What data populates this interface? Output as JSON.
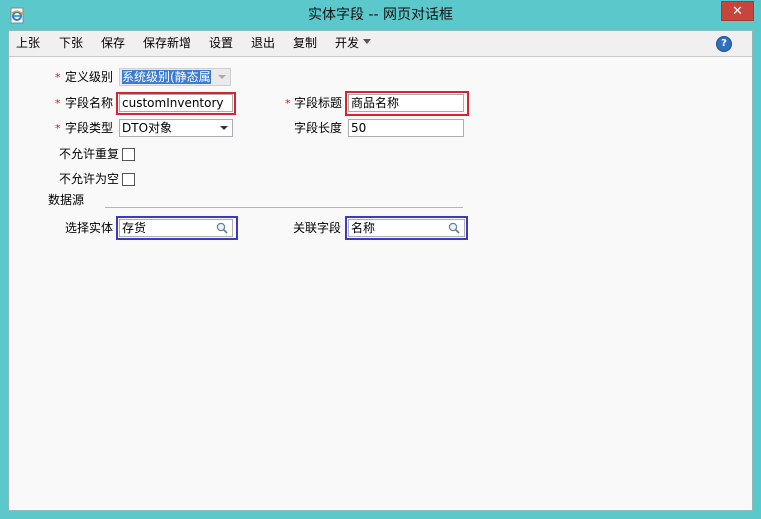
{
  "window": {
    "title": "实体字段 -- 网页对话框",
    "close_label": "✕"
  },
  "menu": {
    "items": [
      "上张",
      "下张",
      "保存",
      "保存新增",
      "设置",
      "退出",
      "复制",
      "开发"
    ],
    "help_label": "?"
  },
  "form": {
    "required_mark": "*",
    "definition_level": {
      "label": "定义级别",
      "value": "系统级别(静态属"
    },
    "field_name": {
      "label": "字段名称",
      "value": "customInventory"
    },
    "field_title": {
      "label": "字段标题",
      "value": "商品名称"
    },
    "field_type": {
      "label": "字段类型",
      "value": "DTO对象"
    },
    "field_length": {
      "label": "字段长度",
      "value": "50"
    },
    "no_duplicate": {
      "label": "不允许重复"
    },
    "no_empty": {
      "label": "不允许为空"
    },
    "datasource": {
      "label": "数据源"
    },
    "select_entity": {
      "label": "选择实体",
      "value": "存货"
    },
    "related_field": {
      "label": "关联字段",
      "value": "名称"
    }
  },
  "colors": {
    "title_bar": "#5bc8cc",
    "highlight_red": "#d8242f",
    "highlight_blue": "#3b3bbd"
  }
}
